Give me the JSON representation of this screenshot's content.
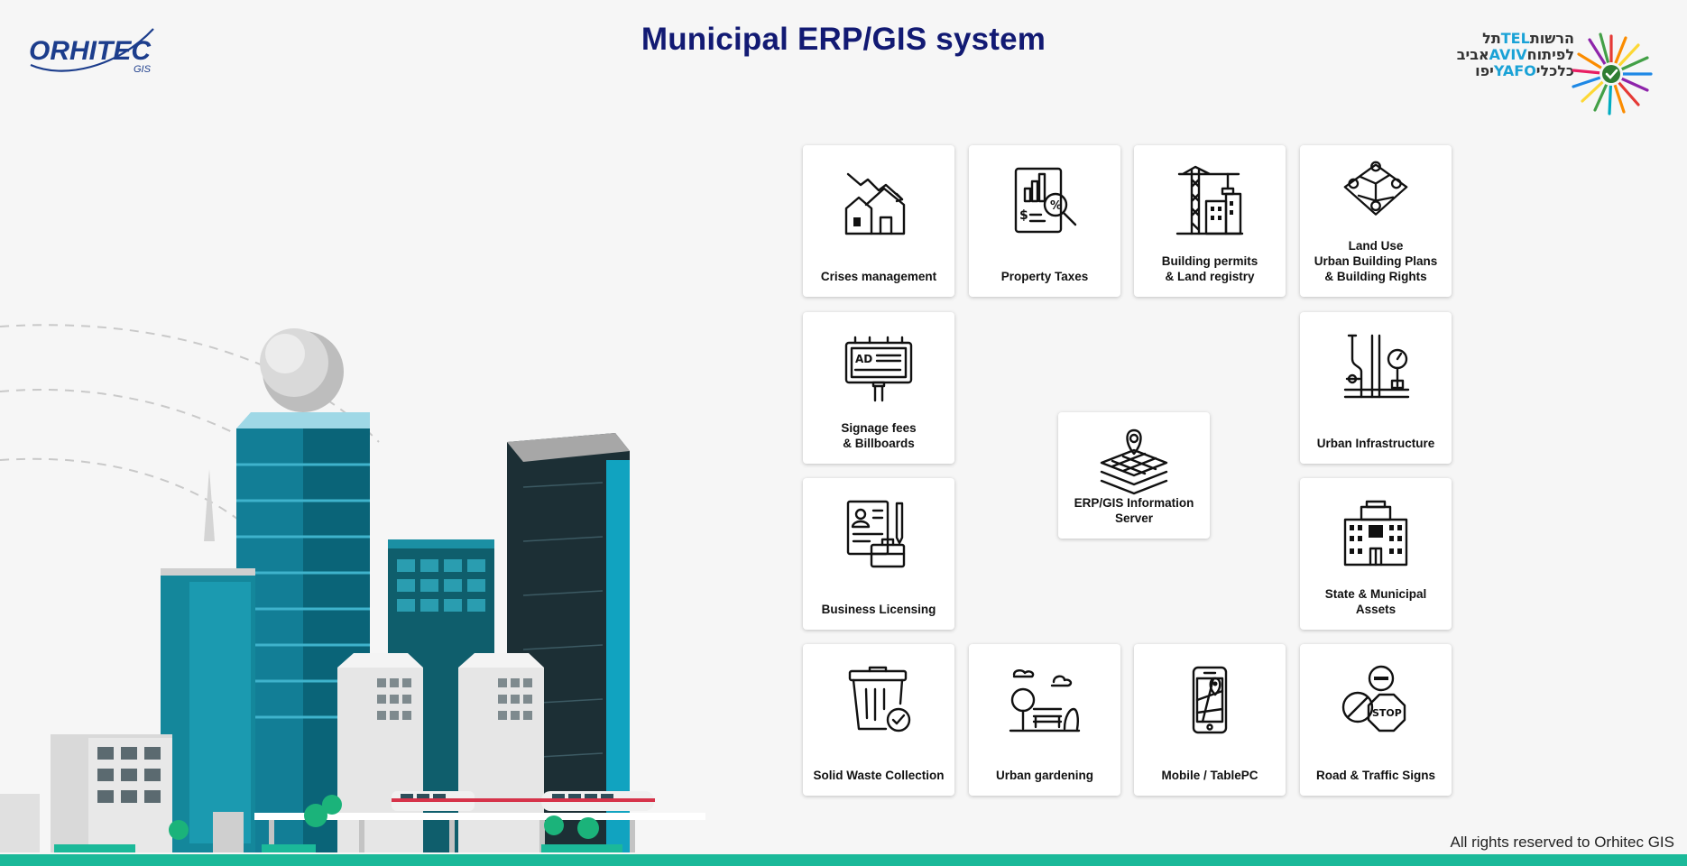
{
  "header": {
    "logo_text": "ORHITEC",
    "logo_sub": "GIS",
    "title": "Municipal ERP/GIS system",
    "partner_logo": {
      "line1_hebrew": "תל",
      "line1_latin": "TEL",
      "line1_hebrew2": "הרשות",
      "line2_hebrew": "אביב",
      "line2_latin": "AVIV",
      "line2_hebrew2": "לפיתוח",
      "line3_hebrew": "יפו",
      "line3_latin": "YAFO",
      "line3_hebrew2": "כלכלי"
    }
  },
  "tiles": {
    "crises": {
      "label": "Crises management",
      "icon": "house-decline-icon"
    },
    "property_taxes": {
      "label": "Property Taxes",
      "icon": "tax-report-icon"
    },
    "building_permits": {
      "label": "Building permits\n& Land registry",
      "icon": "crane-building-icon"
    },
    "land_use": {
      "label": "Land Use\nUrban Building Plans\n& Building Rights",
      "icon": "map-pins-icon"
    },
    "signage": {
      "label": "Signage fees\n& Billboards",
      "icon": "billboard-icon",
      "billboard_text": "AD"
    },
    "infrastructure": {
      "label": "Urban Infrastructure",
      "icon": "pipes-gauge-icon"
    },
    "erp_server": {
      "label": "ERP/GIS Information\nServer",
      "icon": "layers-pin-icon"
    },
    "business_licensing": {
      "label": "Business Licensing",
      "icon": "license-document-icon"
    },
    "municipal_assets": {
      "label": "State & Municipal Assets",
      "icon": "municipal-building-icon"
    },
    "solid_waste": {
      "label": "Solid Waste Collection",
      "icon": "trash-bin-icon"
    },
    "urban_gardening": {
      "label": "Urban gardening",
      "icon": "park-bench-icon"
    },
    "mobile": {
      "label": "Mobile / TablePC",
      "icon": "mobile-map-icon"
    },
    "road_signs": {
      "label": "Road & Traffic Signs",
      "icon": "stop-sign-icon",
      "sign_text": "STOP"
    }
  },
  "footer": {
    "copyright": "All rights reserved to Orhitec GIS"
  },
  "colors": {
    "title": "#121a73",
    "accent": "#1bb999",
    "teal": "#0e7d8c"
  }
}
